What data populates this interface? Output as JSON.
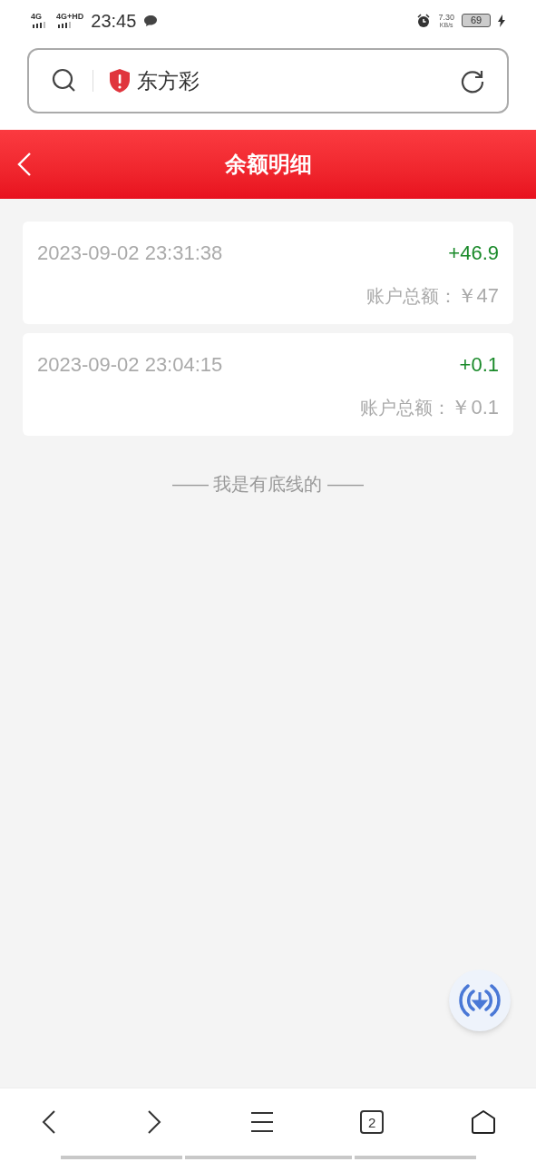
{
  "status_bar": {
    "signal_1": "4G",
    "signal_2": "4G+HD",
    "time": "23:45",
    "speed": "7.30",
    "speed_unit": "KB/s",
    "battery": "69"
  },
  "address_bar": {
    "site": "东方彩"
  },
  "header": {
    "title": "余额明细"
  },
  "records": [
    {
      "time": "2023-09-02 23:31:38",
      "amount": "+46.9",
      "balance_label": "账户总额：",
      "balance": "￥47"
    },
    {
      "time": "2023-09-02 23:04:15",
      "amount": "+0.1",
      "balance_label": "账户总额：",
      "balance": "￥0.1"
    }
  ],
  "end_note": "—— 我是有底线的 ——",
  "bottom_bar": {
    "tab_count": "2"
  }
}
